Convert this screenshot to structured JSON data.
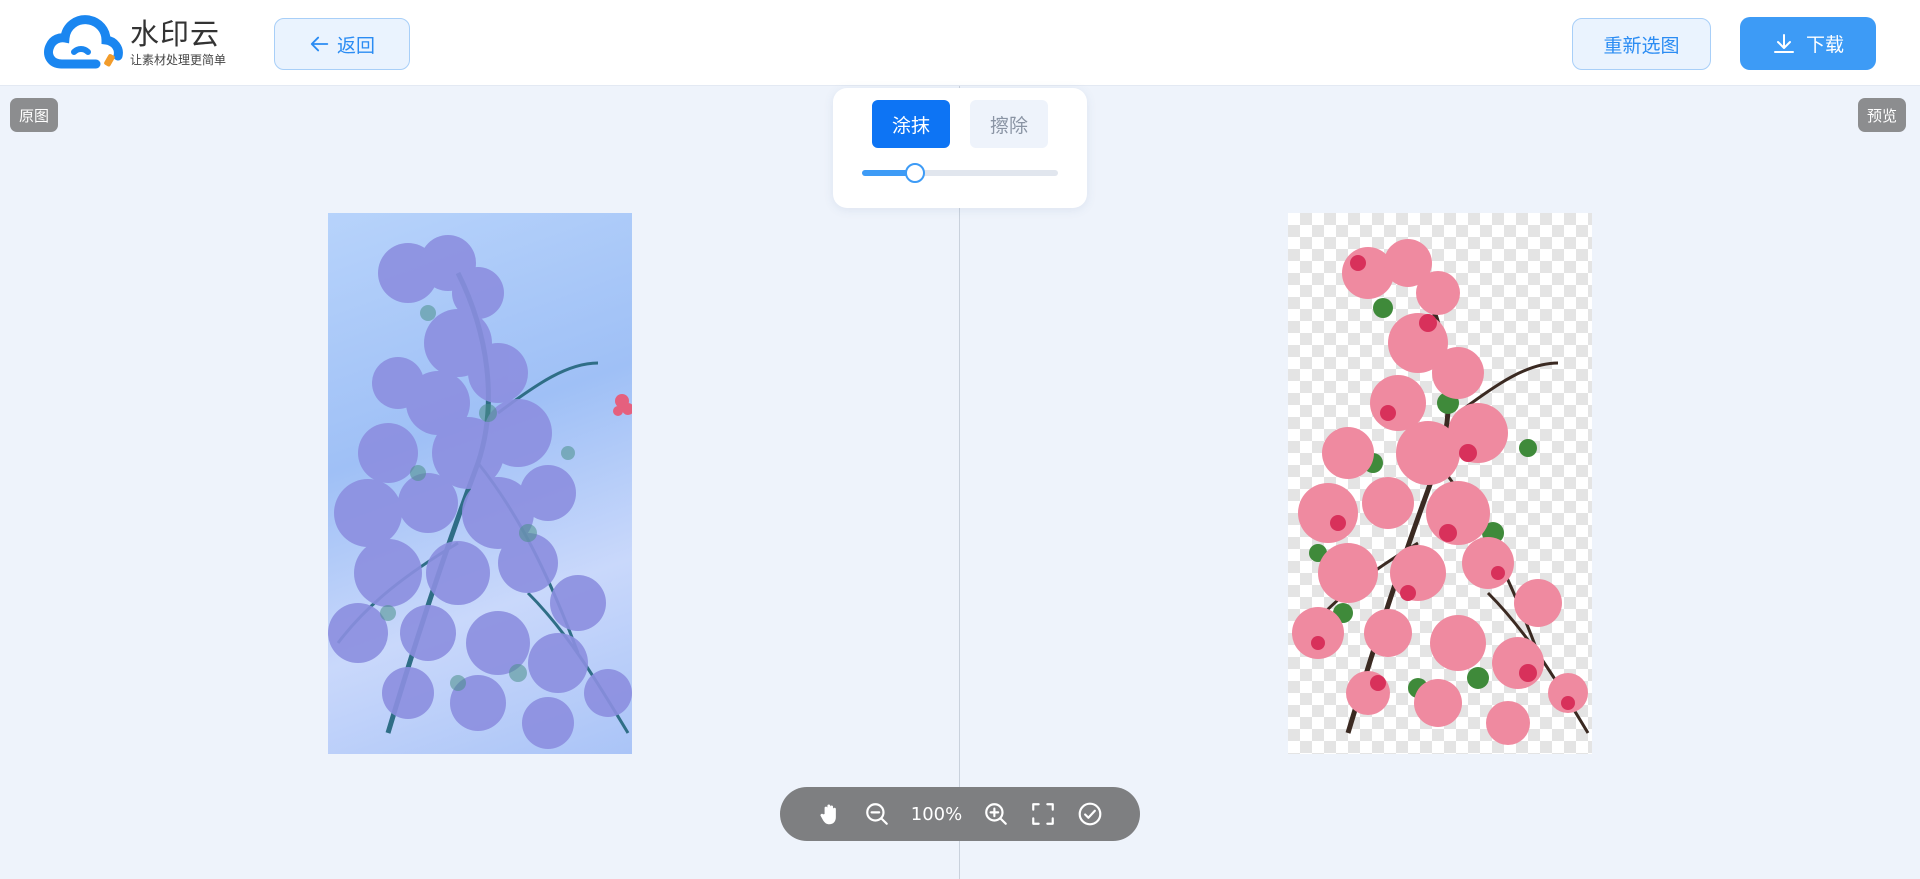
{
  "brand": {
    "name": "水印云",
    "slogan": "让素材处理更简单",
    "colors": {
      "primary": "#3d9bf6",
      "accent": "#0d74f4",
      "logo_orange": "#f29c2b"
    }
  },
  "header": {
    "back_label": "返回",
    "reselect_label": "重新选图",
    "download_label": "下载"
  },
  "labels": {
    "original": "原图",
    "preview": "预览"
  },
  "brush": {
    "paint_label": "涂抹",
    "erase_label": "擦除",
    "active_mode": "涂抹",
    "size_fraction": 0.27
  },
  "toolbar": {
    "zoom": "100%",
    "icons": [
      "hand-icon",
      "zoom-out-icon",
      "zoom-in-icon",
      "fit-screen-icon",
      "confirm-icon"
    ]
  }
}
